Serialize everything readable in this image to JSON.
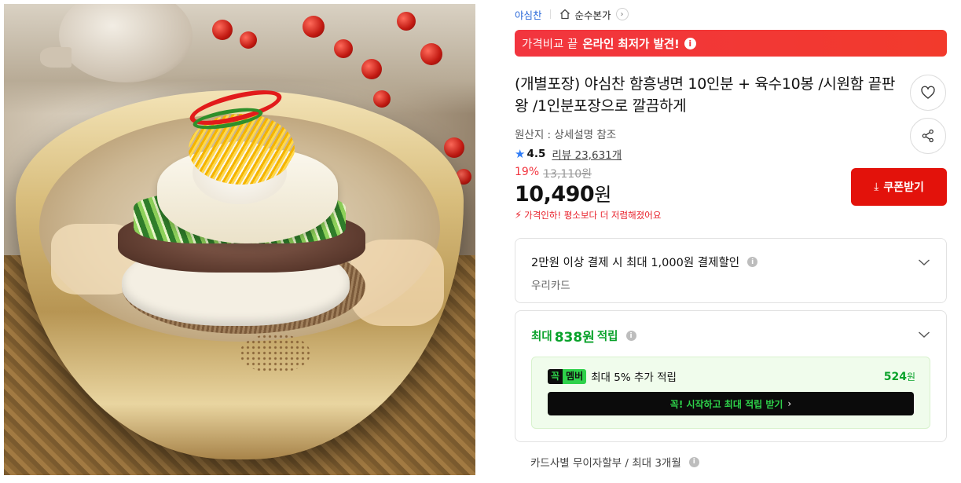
{
  "breadcrumb": {
    "brand": "야심찬",
    "store": "순수본가",
    "store_chevron": "›",
    "home_icon": "home-icon"
  },
  "promo_banner": {
    "light_text": "가격비교 끝",
    "bold_text": "온라인 최저가 발견!",
    "info_glyph": "i"
  },
  "product": {
    "title": "(개별포장) 야심찬 함흥냉면 10인분 + 육수10봉 /시원함 끝판왕 /1인분포장으로 깔끔하게",
    "origin": "원산지 : 상세설명 참조",
    "rating_star": "★",
    "rating": "4.5",
    "reviews": "리뷰 23,631개",
    "discount": "19%",
    "original_price": "13,110원",
    "price_number": "10,490",
    "price_unit": "원",
    "price_drop_icon": "⚡",
    "price_drop_text": "가격인하! 평소보다 더 저렴해졌어요"
  },
  "actions": {
    "coupon_icon": "⤓",
    "coupon_label": "쿠폰받기",
    "wish_icon": "heart-icon",
    "share_icon": "share-icon"
  },
  "payment_benefit": {
    "line1": "2만원 이상 결제 시 최대 1,000원 결제할인",
    "line2": "우리카드",
    "info_glyph": "i"
  },
  "points": {
    "prefix": "최대",
    "amount": "838원",
    "suffix": "적립",
    "info_glyph": "i",
    "member": {
      "logo_k": "꼭",
      "logo_m": "멤버",
      "text": "최대 5% 추가 적립",
      "points_number": "524",
      "points_unit": "원",
      "cta_label": "꼭! 시작하고 최대 적립 받기",
      "cta_arrow": "›"
    }
  },
  "installment": {
    "text": "카드사별 무이자할부 / 최대 3개월",
    "info_glyph": "i"
  },
  "colors": {
    "accent_red": "#e3120b",
    "banner_red": "#f2353f",
    "link_blue": "#2867d8",
    "star_blue": "#2f7cf6",
    "points_green": "#0aa22b",
    "member_green": "#2ed14a"
  }
}
